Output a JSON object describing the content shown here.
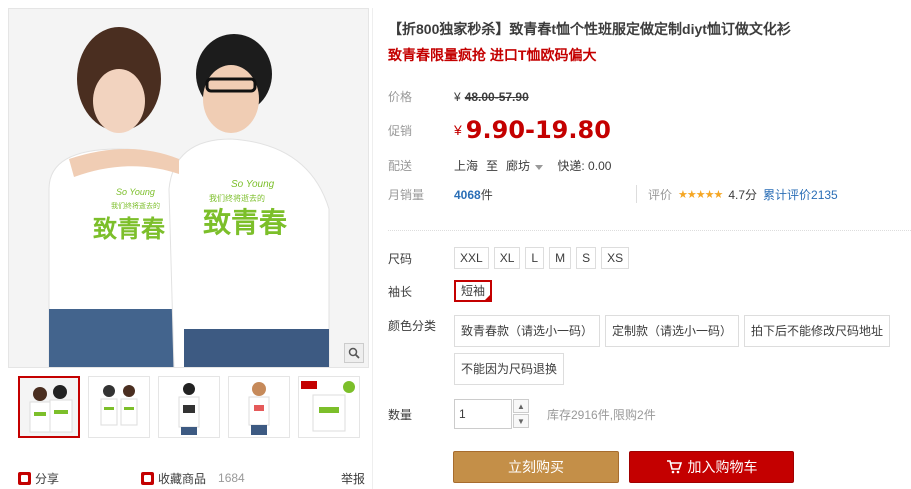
{
  "product": {
    "title": "【折800独家秒杀】致青春t恤个性班服定做定制diyt恤订做文化衫",
    "subtitle": "致青春限量疯抢 进口T恤欧码偏大"
  },
  "price": {
    "label": "价格",
    "currency": "¥",
    "original": "48.00-57.90"
  },
  "promo": {
    "label": "促销",
    "currency": "¥",
    "value": "9.90-19.80"
  },
  "shipping": {
    "label": "配送",
    "from": "上海",
    "to_word": "至",
    "to": "廊坊",
    "fee": "快递: 0.00"
  },
  "sales": {
    "label": "月销量",
    "count": "4068",
    "unit": "件"
  },
  "rating": {
    "label": "评价",
    "stars": "★★★★★",
    "score": "4.7分",
    "link": "累计评价2135"
  },
  "size": {
    "label": "尺码",
    "options": [
      "XXL",
      "XL",
      "L",
      "M",
      "S",
      "XS"
    ]
  },
  "sleeve": {
    "label": "袖长",
    "options": [
      "短袖"
    ]
  },
  "color": {
    "label": "颜色分类",
    "options": [
      "致青春款（请选小一码）",
      "定制款（请选小一码）",
      "拍下后不能修改尺码地址",
      "不能因为尺码退换"
    ]
  },
  "quantity": {
    "label": "数量",
    "value": "1",
    "stock": "库存2916件,限购2件"
  },
  "actions": {
    "buy": "立刻购买",
    "cart": "加入购物车"
  },
  "gallery": {
    "share": "分享",
    "favorite": "收藏商品",
    "favorite_count": "1684",
    "report": "举报",
    "print_text_1": "致青春",
    "print_text_2": "So Young",
    "print_text_3": "我们终将逝去的"
  },
  "colors": {
    "accent": "#c40000",
    "buy_button": "#c48f48",
    "link": "#2a6eb6",
    "print_green": "#7cbf2a"
  }
}
